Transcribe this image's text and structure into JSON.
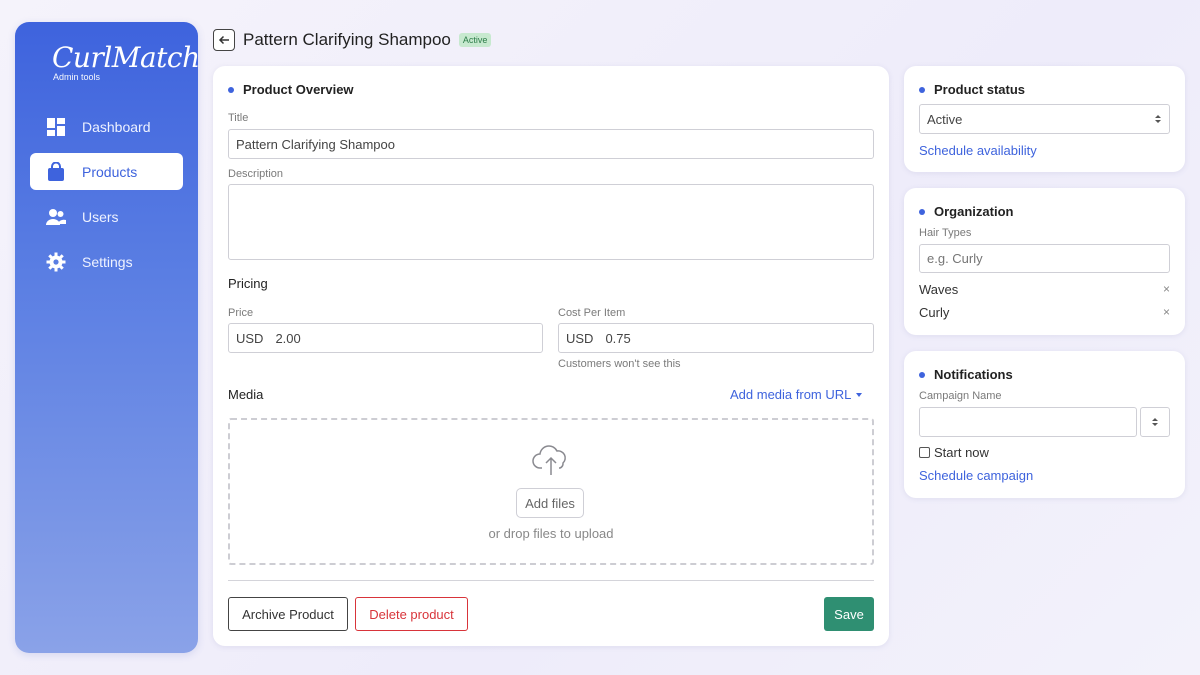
{
  "brand": {
    "name": "CurlMatch",
    "subtitle": "Admin tools"
  },
  "sidebar": {
    "items": [
      {
        "label": "Dashboard",
        "icon": "dashboard-icon",
        "active": false
      },
      {
        "label": "Products",
        "icon": "shopping-bag-icon",
        "active": true
      },
      {
        "label": "Users",
        "icon": "users-icon",
        "active": false
      },
      {
        "label": "Settings",
        "icon": "gear-icon",
        "active": false
      }
    ]
  },
  "header": {
    "title": "Pattern Clarifying Shampoo",
    "status_badge": "Active"
  },
  "overview": {
    "section_title": "Product Overview",
    "title_label": "Title",
    "title_value": "Pattern Clarifying Shampoo",
    "description_label": "Description",
    "description_value": ""
  },
  "pricing": {
    "section_title": "Pricing",
    "price_label": "Price",
    "price_currency": "USD",
    "price_value": "2.00",
    "cost_label": "Cost Per Item",
    "cost_currency": "USD",
    "cost_value": "0.75",
    "cost_help": "Customers won't see this"
  },
  "media": {
    "section_title": "Media",
    "add_from_url": "Add media from URL",
    "add_files": "Add files",
    "drop_hint": "or drop files to upload"
  },
  "actions": {
    "archive": "Archive Product",
    "delete": "Delete product",
    "save": "Save"
  },
  "product_status": {
    "title": "Product status",
    "selected": "Active",
    "schedule_link": "Schedule availability"
  },
  "organization": {
    "title": "Organization",
    "hair_types_label": "Hair Types",
    "hair_types_placeholder": "e.g. Curly",
    "tags": [
      "Waves",
      "Curly"
    ],
    "remove_symbol": "×"
  },
  "notifications": {
    "title": "Notifications",
    "campaign_label": "Campaign Name",
    "campaign_value": "",
    "start_now_label": "Start now",
    "start_now_checked": false,
    "schedule_link": "Schedule campaign"
  },
  "colors": {
    "accent": "#3e63dd",
    "save": "#2f8f72",
    "danger": "#d8343a",
    "badge_bg": "#c7e9cf",
    "badge_text": "#2e7d4a"
  }
}
